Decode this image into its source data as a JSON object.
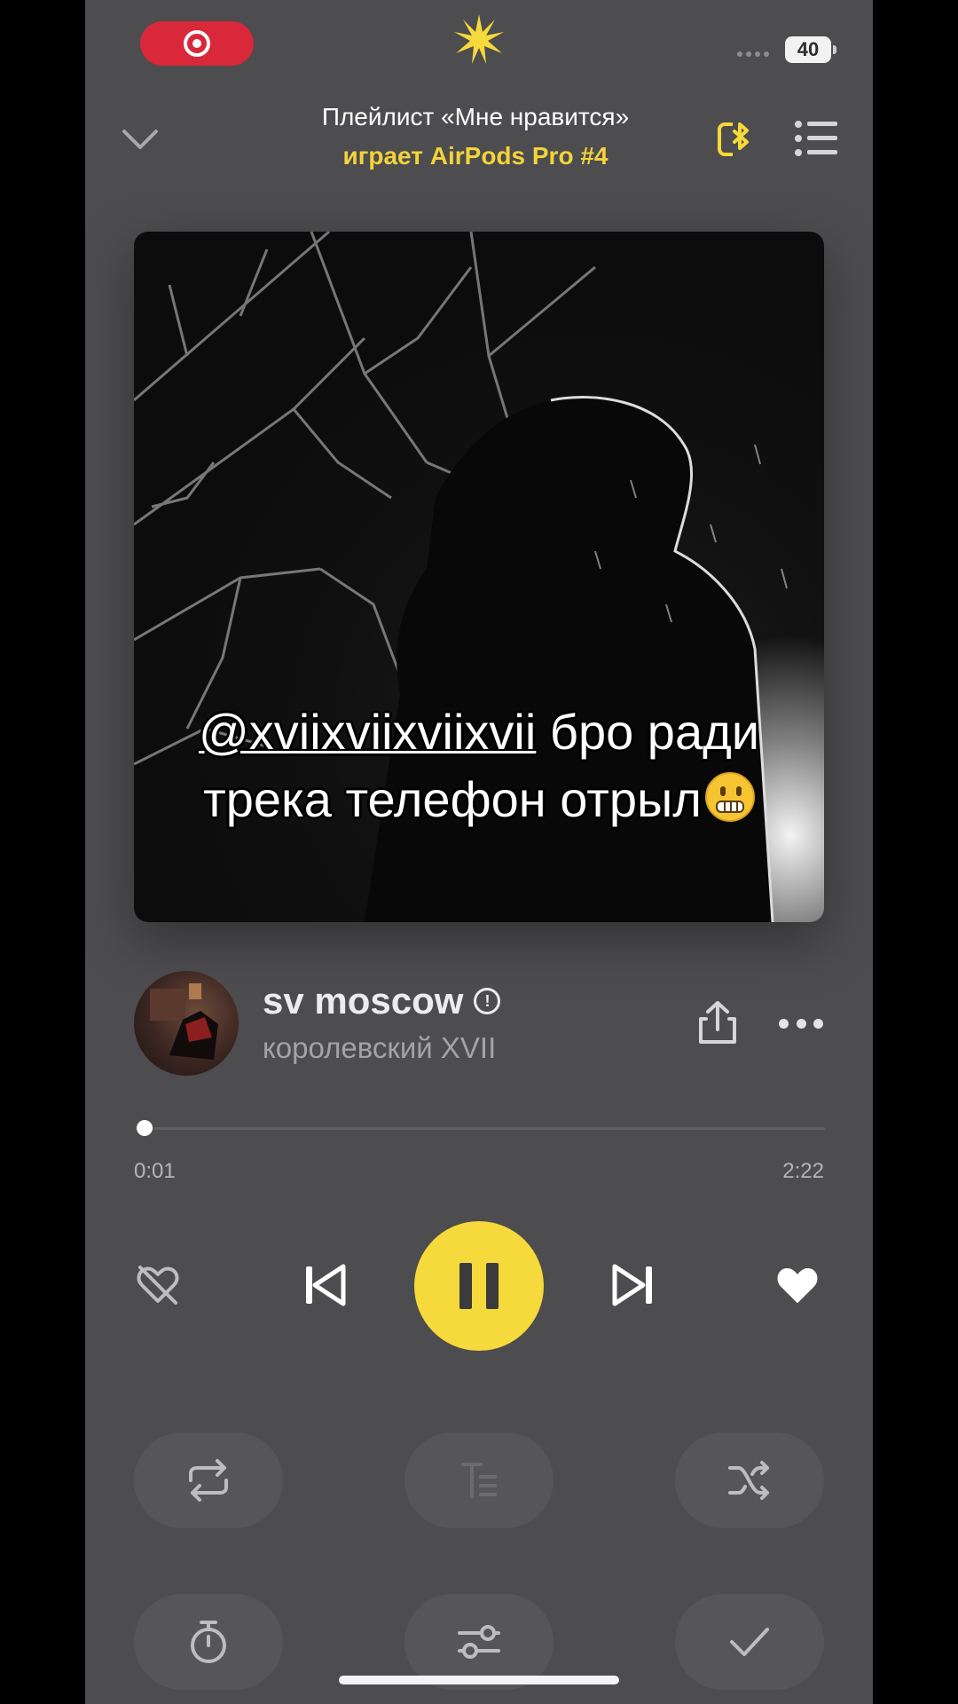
{
  "status_bar": {
    "battery_level": "40",
    "recording_indicator": "record-dot-icon",
    "app_logo": "sun-burst-icon",
    "record_color": "#d8283a"
  },
  "header": {
    "title": "Плейлист «Мне нравится»",
    "subtitle": "играет AirPods Pro #4",
    "subtitle_color": "#f2d33a",
    "collapse_icon": "chevron-down-icon",
    "device_icon": "bluetooth-device-icon",
    "queue_icon": "queue-list-icon"
  },
  "cover": {
    "caption_mention": "@xviixviixviixvii",
    "caption_line1_rest": " бро ради",
    "caption_line2": "трека телефон отрыл",
    "caption_emoji": "grimacing-face-emoji"
  },
  "track": {
    "title": "sv moscow",
    "explicit_icon": "explicit-icon",
    "artist": "королевский XVII",
    "share_icon": "share-icon",
    "more_icon": "more-dots-icon"
  },
  "progress": {
    "current_time": "0:01",
    "total_time": "2:22",
    "fraction": 0.007
  },
  "controls": {
    "dislike_icon": "dislike-icon",
    "prev_icon": "skip-previous-icon",
    "play_state": "playing",
    "pause_icon": "pause-icon",
    "play_color": "#f6d93a",
    "next_icon": "skip-next-icon",
    "like_icon": "heart-filled-icon"
  },
  "options_row1": [
    "repeat-icon",
    "lyrics-icon",
    "shuffle-icon"
  ],
  "options_row2": [
    "timer-icon",
    "equalizer-icon",
    "check-icon"
  ]
}
